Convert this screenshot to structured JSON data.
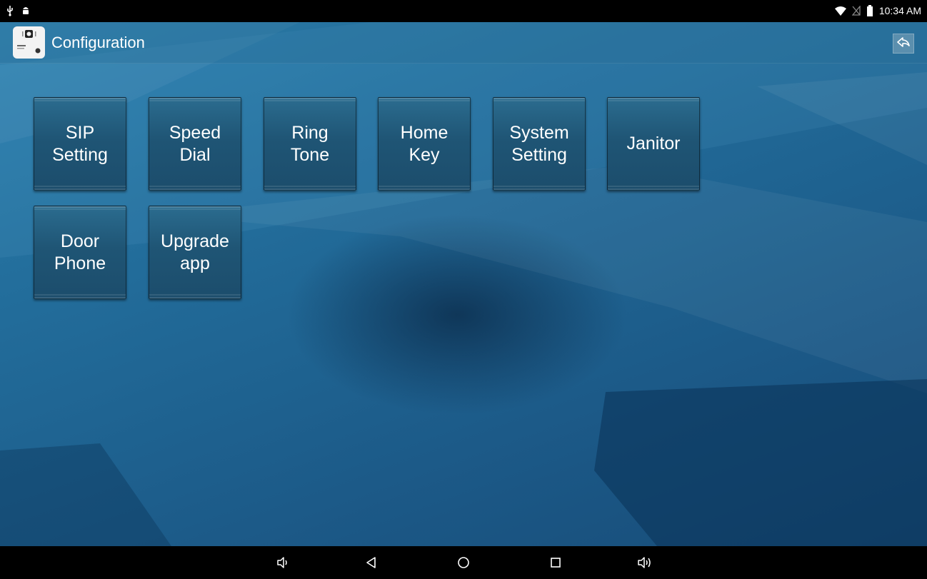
{
  "status_bar": {
    "time": "10:34 AM",
    "left_icons": [
      "usb-icon",
      "android-debug-icon"
    ],
    "right_icons": [
      "wifi-icon",
      "no-sim-icon",
      "battery-icon"
    ]
  },
  "action_bar": {
    "title": "Configuration",
    "logo_icon": "app-logo-icon",
    "back_icon": "reply-back-icon"
  },
  "tiles": [
    {
      "label": "SIP\nSetting"
    },
    {
      "label": "Speed\nDial"
    },
    {
      "label": "Ring\nTone"
    },
    {
      "label": "Home\nKey"
    },
    {
      "label": "System\nSetting"
    },
    {
      "label": "Janitor"
    },
    {
      "label": "Door\nPhone"
    },
    {
      "label": "Upgrade\napp"
    }
  ],
  "nav_bar": {
    "buttons": [
      "volume-down-icon",
      "back-icon",
      "home-icon",
      "recents-icon",
      "volume-up-icon"
    ]
  },
  "colors": {
    "background_top": "#2a7fae",
    "background_bottom": "#174c78",
    "tile": "#1f5575",
    "bar": "#000000"
  }
}
